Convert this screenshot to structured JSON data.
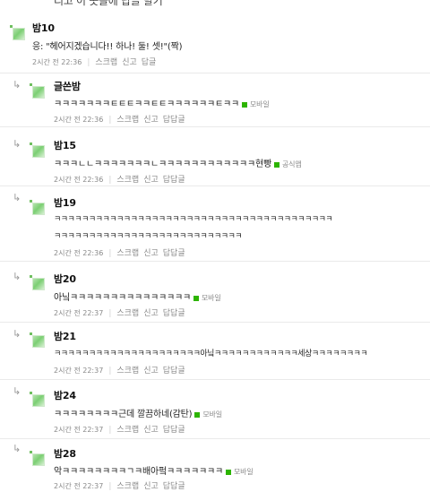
{
  "cutoff_text": "리고 이 곳들에 답글 달기",
  "labels": {
    "scrap": "스크랩",
    "report": "신고",
    "reply": "답글",
    "rereply": "답답글"
  },
  "comments": [
    {
      "name": "밤10",
      "text": "응: \"헤어지겠습니다!! 하나! 둘! 셋!\"(짝)",
      "time": "2시간 전 22:36"
    },
    {
      "name": "글쓴밤",
      "text": "ㅋㅋㅋㅋㅋㅋㅋㅌㅌㅌㅋㅋㅌㅌㅋㅋㅋㅋㅋㅋㅌㅋㅋ",
      "tag": "모바일",
      "time": "2시간 전 22:36"
    },
    {
      "name": "밤15",
      "text": "ㅋㅋㅋㄴㄴㅋㅋㅋㅋㅋㅋㅋㄴㅋㅋㅋㅋㅋㅋㅋㅋㅋㅋㅋㅋ현빵",
      "tag": "공식앱",
      "time": "2시간 전 22:36"
    },
    {
      "name": "밤19",
      "text": "ㅋㅋㅋㅋㅋㅋㅋㅋㅋㅋㅋㅋㅋㅋㅋㅋㅋㅋㅋㅋㅋㅋㅋㅋㅋㅋㅋㅋㅋㅋㅋㅋㅋㅋㅋㅋㅋㅋㅋㅋ",
      "text2": "ㅋㅋㅋㅋㅋㅋㅋㅋㅋㅋㅋㅋㅋㅋㅋㅋㅋㅋㅋㅋㅋㅋㅋㅋㅋㅋㅋ",
      "time": "2시간 전 22:36"
    },
    {
      "name": "밤20",
      "text": "아닠ㅋㅋㅋㅋㅋㅋㅋㅋㅋㅋㅋㅋㅋㅋㅋ",
      "tag": "모바일",
      "time": "2시간 전 22:37"
    },
    {
      "name": "밤21",
      "text": "ㅋㅋㅋㅋㅋㅋㅋㅋㅋㅋㅋㅋㅋㅋㅋㅋㅋㅋㅋㅋㅋ아닠ㅋㅋㅋㅋㅋㅋㅋㅋㅋㅋㅋㅋ세상ㅋㅋㅋㅋㅋㅋㅋㅋ",
      "time": "2시간 전 22:37"
    },
    {
      "name": "밤24",
      "text": "ㅋㅋㅋㅋㅋㅋㅋㅋ근데 깔끔하네(감탄)",
      "tag": "모바일",
      "time": "2시간 전 22:37"
    },
    {
      "name": "밤28",
      "text": "악ㅋㅋㅋㅋㅋㅋㅋㅋㄱㅋ배아펔ㅋㅋㅋㅋㅋㅋㅋ",
      "tag": "모바일",
      "time": "2시간 전 22:37"
    }
  ]
}
